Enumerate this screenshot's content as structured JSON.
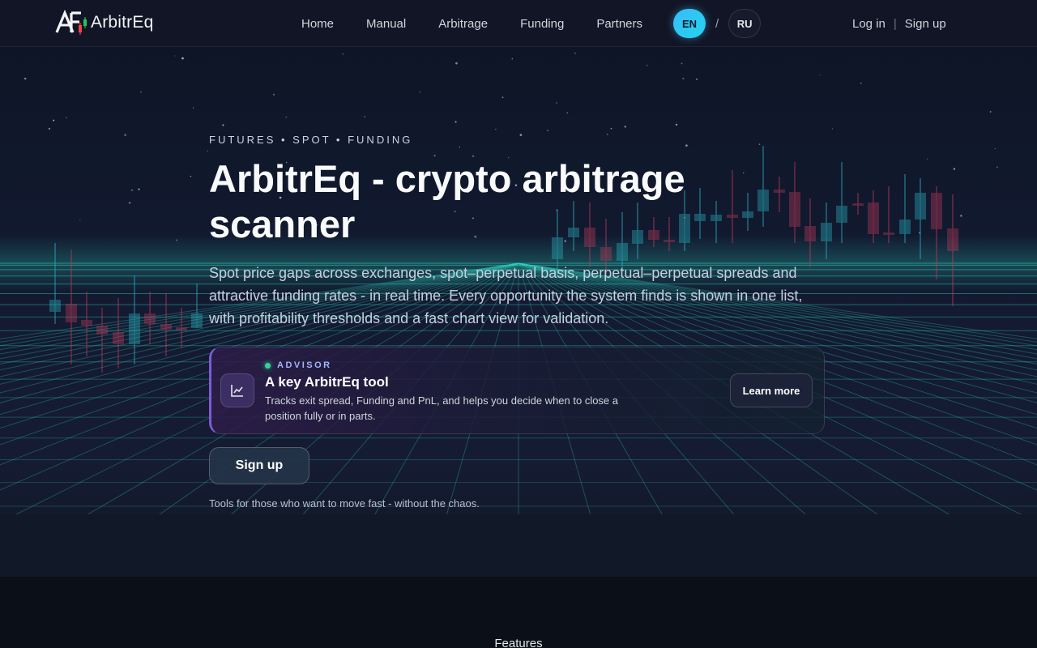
{
  "brand": {
    "name": "ArbitrEq",
    "logo_mark": "AE"
  },
  "nav": {
    "links": [
      {
        "label": "Home"
      },
      {
        "label": "Manual"
      },
      {
        "label": "Arbitrage"
      },
      {
        "label": "Funding"
      },
      {
        "label": "Partners"
      }
    ],
    "languages": {
      "active": "EN",
      "other": "RU",
      "separator": "/"
    },
    "auth": {
      "login": "Log in",
      "separator": "|",
      "signup": "Sign up"
    }
  },
  "hero": {
    "eyebrow": "FUTURES • SPOT • FUNDING",
    "title": "ArbitrEq - crypto arbitrage scanner",
    "lede": "Spot price gaps across exchanges, spot–perpetual basis, perpetual–perpetual spreads and attractive funding rates - in real time. Every opportunity the system finds is shown in one list, with profitability thresholds and a fast chart view for validation.",
    "advisor": {
      "tag": "ADVISOR",
      "icon": "chart-trend-icon",
      "title": "A key ArbitrEq tool",
      "description": "Tracks exit spread, Funding and PnL, and helps you decide when to close a position fully or in parts.",
      "button": "Learn more"
    },
    "cta": "Sign up",
    "tagline": "Tools for those who want to move fast - without the chaos."
  },
  "features": {
    "heading": "Features"
  },
  "colors": {
    "accent_cyan": "#22d3ee",
    "grid_teal": "#2dd4bf",
    "candle_up": "#2bb3c0",
    "candle_down": "#c0395a",
    "advisor_accent": "#7c5cd6"
  }
}
